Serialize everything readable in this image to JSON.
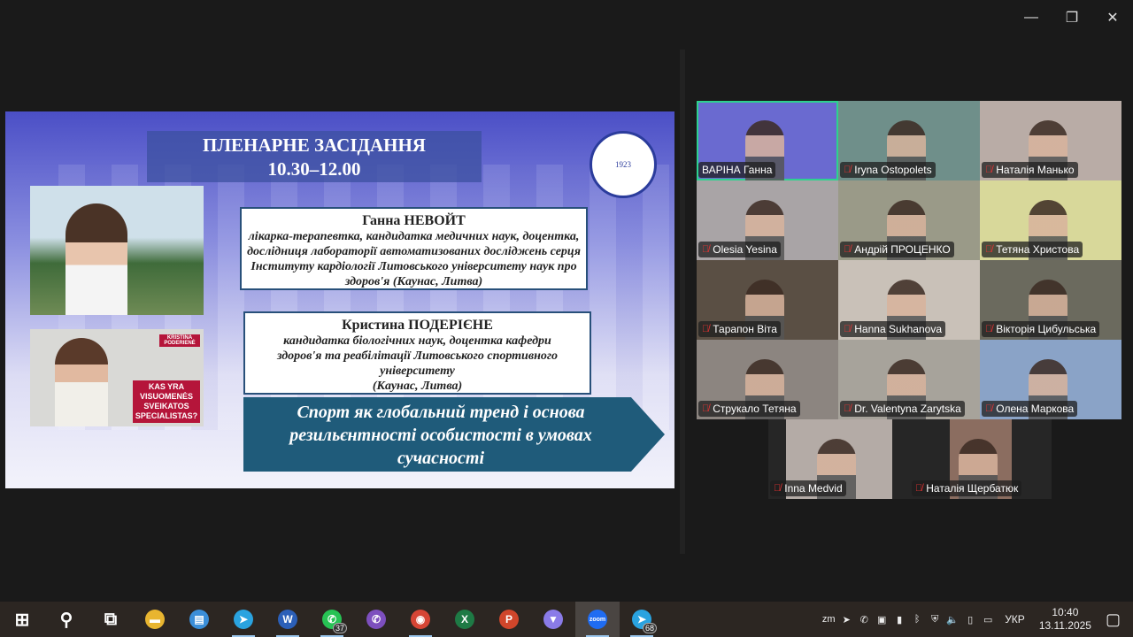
{
  "window": {
    "minimize": "—",
    "restore": "❐",
    "close": "✕"
  },
  "slide": {
    "title": "ПЛЕНАРНЕ ЗАСІДАННЯ",
    "time": "10.30–12.00",
    "logo_year": "1923",
    "speaker1": {
      "name": "Ганна НЕВОЙТ",
      "desc": "лікарка-терапевтка, кандидатка медичних наук, доцентка, дослідниця лабораторії автоматизованих досліджень серця Інституту кардіології Литовського університету наук про здоров'я (Каунас, Литва)"
    },
    "speaker2": {
      "name": "Кристина ПОДЕРІЄНЕ",
      "desc": "кандидатка біологічних наук, доцентка кафедри здоров'я та реабілітації Литовського спортивного університету",
      "location": "(Каунас, Литва)"
    },
    "photo2_caption": {
      "name": "KRISTINA PODERIENĖ",
      "question": "KAS YRA VISUOMENĖS SVEIKATOS SPECIALISTAS?"
    },
    "topic": "Спорт як глобальний тренд і основа резильєнтності особистості в умовах сучасності"
  },
  "participants": [
    {
      "name": "ВАРІНА Ганна",
      "muted": false,
      "active": true,
      "bg": "#6a6ad0"
    },
    {
      "name": "Iryna Ostopolets",
      "muted": true,
      "bg": "#6f8f8a"
    },
    {
      "name": "Наталія Манько",
      "muted": true,
      "bg": "#b9aca6"
    },
    {
      "name": "Olesia Yesina",
      "muted": true,
      "bg": "#a9a4a6"
    },
    {
      "name": "Андрій ПРОЦЕНКО",
      "muted": true,
      "bg": "#9a9a88"
    },
    {
      "name": "Тетяна Христова",
      "muted": true,
      "bg": "#d8d89a"
    },
    {
      "name": "Тарапон Віта",
      "muted": true,
      "bg": "#5a4f44"
    },
    {
      "name": "Hanna Sukhanova",
      "muted": true,
      "bg": "#c9c1b8"
    },
    {
      "name": "Вікторія Цибульська",
      "muted": true,
      "bg": "#6b6a5e"
    },
    {
      "name": "Струкало Тетяна",
      "muted": true,
      "bg": "#8c8580"
    },
    {
      "name": "Dr. Valentyna Zarytska",
      "muted": true,
      "bg": "#a7a39b"
    },
    {
      "name": "Олена Маркова",
      "muted": true,
      "bg": "#8aa3c7"
    },
    {
      "name": "Inna Medvid",
      "muted": true,
      "bg": "#b4aba6"
    },
    {
      "name": "Наталія Щербатюк",
      "muted": true,
      "bg": "#8b6d60"
    }
  ],
  "taskbar": {
    "apps": [
      {
        "name": "start",
        "glyph": "⊞",
        "color": "transparent"
      },
      {
        "name": "search",
        "glyph": "⚲",
        "color": "transparent"
      },
      {
        "name": "task-view",
        "glyph": "⧉",
        "color": "transparent"
      },
      {
        "name": "file-explorer",
        "glyph": "▬",
        "color": "#e8b530"
      },
      {
        "name": "control-panel",
        "glyph": "▤",
        "color": "#3b8ed8"
      },
      {
        "name": "telegram",
        "glyph": "➤",
        "color": "#2aa3e0",
        "run": true
      },
      {
        "name": "word",
        "glyph": "W",
        "color": "#2b5fb8",
        "run": true
      },
      {
        "name": "whatsapp",
        "glyph": "✆",
        "color": "#27c254",
        "run": true,
        "badge": "37"
      },
      {
        "name": "viber",
        "glyph": "✆",
        "color": "#7d4fbe"
      },
      {
        "name": "chrome",
        "glyph": "◉",
        "color": "#d64535",
        "run": true
      },
      {
        "name": "excel",
        "glyph": "X",
        "color": "#1e7a45"
      },
      {
        "name": "powerpoint",
        "glyph": "P",
        "color": "#d0462b"
      },
      {
        "name": "vpn",
        "glyph": "▼",
        "color": "#8a7be8"
      },
      {
        "name": "zoom",
        "glyph": "zoom",
        "color": "#1f6cf2",
        "run": true,
        "selected": true
      },
      {
        "name": "telegram-2",
        "glyph": "➤",
        "color": "#2aa3e0",
        "run": true,
        "badge": "68"
      }
    ],
    "tray": [
      "zm",
      "➤",
      "✆",
      "▣",
      "▮",
      "ᛒ",
      "⛨",
      "🔈",
      "▯",
      "▭"
    ],
    "language": "УКР",
    "time": "10:40",
    "date": "13.11.2025",
    "notifications": "▢"
  }
}
